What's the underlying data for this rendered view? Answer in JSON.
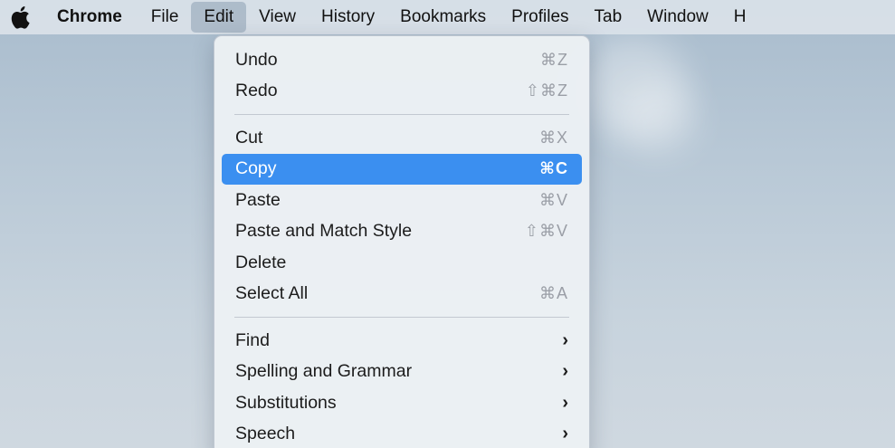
{
  "menubar": {
    "items": [
      "Chrome",
      "File",
      "Edit",
      "View",
      "History",
      "Bookmarks",
      "Profiles",
      "Tab",
      "Window",
      "H"
    ]
  },
  "edit_menu": {
    "undo": {
      "label": "Undo",
      "shortcut": "⌘Z"
    },
    "redo": {
      "label": "Redo",
      "shortcut": "⇧⌘Z"
    },
    "cut": {
      "label": "Cut",
      "shortcut": "⌘X"
    },
    "copy": {
      "label": "Copy",
      "shortcut": "⌘C"
    },
    "paste": {
      "label": "Paste",
      "shortcut": "⌘V"
    },
    "paste_match": {
      "label": "Paste and Match Style",
      "shortcut": "⇧⌘V"
    },
    "delete": {
      "label": "Delete"
    },
    "select_all": {
      "label": "Select All",
      "shortcut": "⌘A"
    },
    "find": {
      "label": "Find"
    },
    "spelling": {
      "label": "Spelling and Grammar"
    },
    "substitutions": {
      "label": "Substitutions"
    },
    "speech": {
      "label": "Speech"
    },
    "submenu_glyph": "›"
  },
  "colors": {
    "selection": "#3b8ff0"
  }
}
